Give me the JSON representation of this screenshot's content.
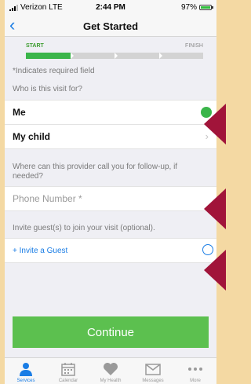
{
  "status": {
    "carrier": "Verizon LTE",
    "time": "2:44 PM",
    "battery": "97%"
  },
  "nav": {
    "title": "Get Started"
  },
  "progress": {
    "start": "START",
    "finish": "FINISH",
    "completed_steps": 1,
    "total_steps": 4
  },
  "form": {
    "required_note": "*Indicates required field",
    "who_question": "Who is this visit for?",
    "options": [
      "Me",
      "My child"
    ],
    "phone_question": "Where can this provider call you for follow-up, if needed?",
    "phone_placeholder": "Phone Number *",
    "guest_question": "Invite guest(s) to join your visit (optional).",
    "invite_label": "+ Invite a Guest"
  },
  "continue_label": "Continue",
  "tabs": [
    {
      "label": "Services",
      "icon": "person-icon"
    },
    {
      "label": "Calendar",
      "icon": "calendar-icon"
    },
    {
      "label": "My Health",
      "icon": "heart-icon"
    },
    {
      "label": "Messages",
      "icon": "envelope-icon"
    },
    {
      "label": "More",
      "icon": "more-icon"
    }
  ],
  "colors": {
    "accent": "#1a7de5",
    "success": "#5cc04f",
    "pointer": "#a1143a",
    "background": "#f4d9a3"
  }
}
